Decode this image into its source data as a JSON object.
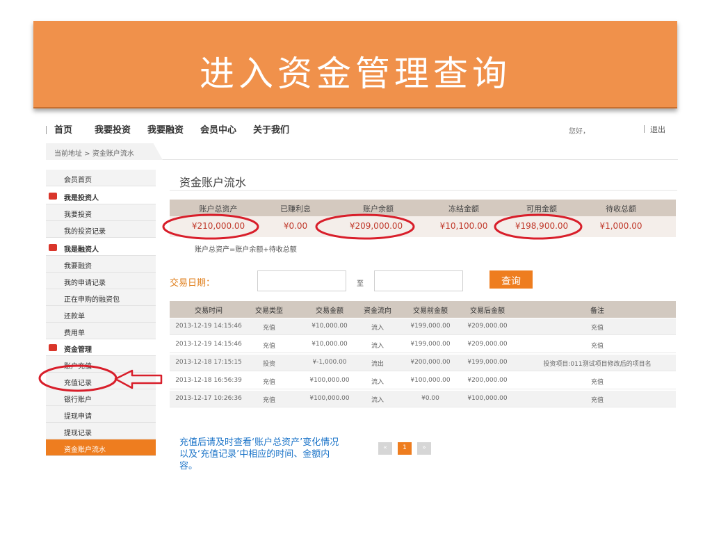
{
  "slide": {
    "title": "进入资金管理查询",
    "banner_color": "#f0914b"
  },
  "nav": {
    "items": [
      "首页",
      "我要投资",
      "我要融资",
      "会员中心",
      "关于我们"
    ],
    "greeting": "您好，",
    "logout": "退出"
  },
  "breadcrumb": "当前地址 > 资金账户流水",
  "sidebar": {
    "items": [
      {
        "label": "会员首页",
        "type": "item"
      },
      {
        "label": "我是投资人",
        "type": "group"
      },
      {
        "label": "我要投资",
        "type": "item"
      },
      {
        "label": "我的投资记录",
        "type": "item"
      },
      {
        "label": "我是融资人",
        "type": "group"
      },
      {
        "label": "我要融资",
        "type": "item"
      },
      {
        "label": "我的申请记录",
        "type": "item"
      },
      {
        "label": "正在申购的融资包",
        "type": "item"
      },
      {
        "label": "还款单",
        "type": "item"
      },
      {
        "label": "费用单",
        "type": "item"
      },
      {
        "label": "资金管理",
        "type": "group"
      },
      {
        "label": "账户充值",
        "type": "item"
      },
      {
        "label": "充值记录",
        "type": "item"
      },
      {
        "label": "银行账户",
        "type": "item"
      },
      {
        "label": "提现申请",
        "type": "item"
      },
      {
        "label": "提现记录",
        "type": "item"
      },
      {
        "label": "资金账户流水",
        "type": "active"
      }
    ]
  },
  "main": {
    "title": "资金账户流水",
    "summary": {
      "headers": [
        "账户总资产",
        "已赚利息",
        "账户余额",
        "冻结金额",
        "可用金额",
        "待收总额"
      ],
      "values": [
        "¥210,000.00",
        "¥0.00",
        "¥209,000.00",
        "¥10,100.00",
        "¥198,900.00",
        "¥1,000.00"
      ],
      "note": "账户总资产=账户余额+待收总额"
    },
    "filter": {
      "label": "交易日期：",
      "to": "至",
      "query": "查询"
    },
    "transactions": {
      "headers": [
        "交易时间",
        "交易类型",
        "交易金额",
        "资金流向",
        "交易前金额",
        "交易后金额",
        "备注"
      ],
      "rows": [
        [
          "2013-12-19 14:15:46",
          "充值",
          "¥10,000.00",
          "流入",
          "¥199,000.00",
          "¥209,000.00",
          "充值"
        ],
        [
          "2013-12-19 14:15:46",
          "充值",
          "¥10,000.00",
          "流入",
          "¥199,000.00",
          "¥209,000.00",
          "充值"
        ],
        [
          "2013-12-18 17:15:15",
          "投资",
          "¥-1,000.00",
          "流出",
          "¥200,000.00",
          "¥199,000.00",
          "投资项目:011测试项目修改后的项目名"
        ],
        [
          "2013-12-18 16:56:39",
          "充值",
          "¥100,000.00",
          "流入",
          "¥100,000.00",
          "¥200,000.00",
          "充值"
        ],
        [
          "2013-12-17 10:26:36",
          "充值",
          "¥100,000.00",
          "流入",
          "¥0.00",
          "¥100,000.00",
          "充值"
        ]
      ]
    },
    "pager": {
      "prev": "«",
      "current": "1",
      "next": "»"
    }
  },
  "annotation": "充值后请及时查看‘账户总资产’变化情况以及‘充值记录’中相应的时间、金额内容。",
  "colors": {
    "accent": "#ee7d1f",
    "highlight": "#d81e2a",
    "annotation": "#1a73c8"
  }
}
